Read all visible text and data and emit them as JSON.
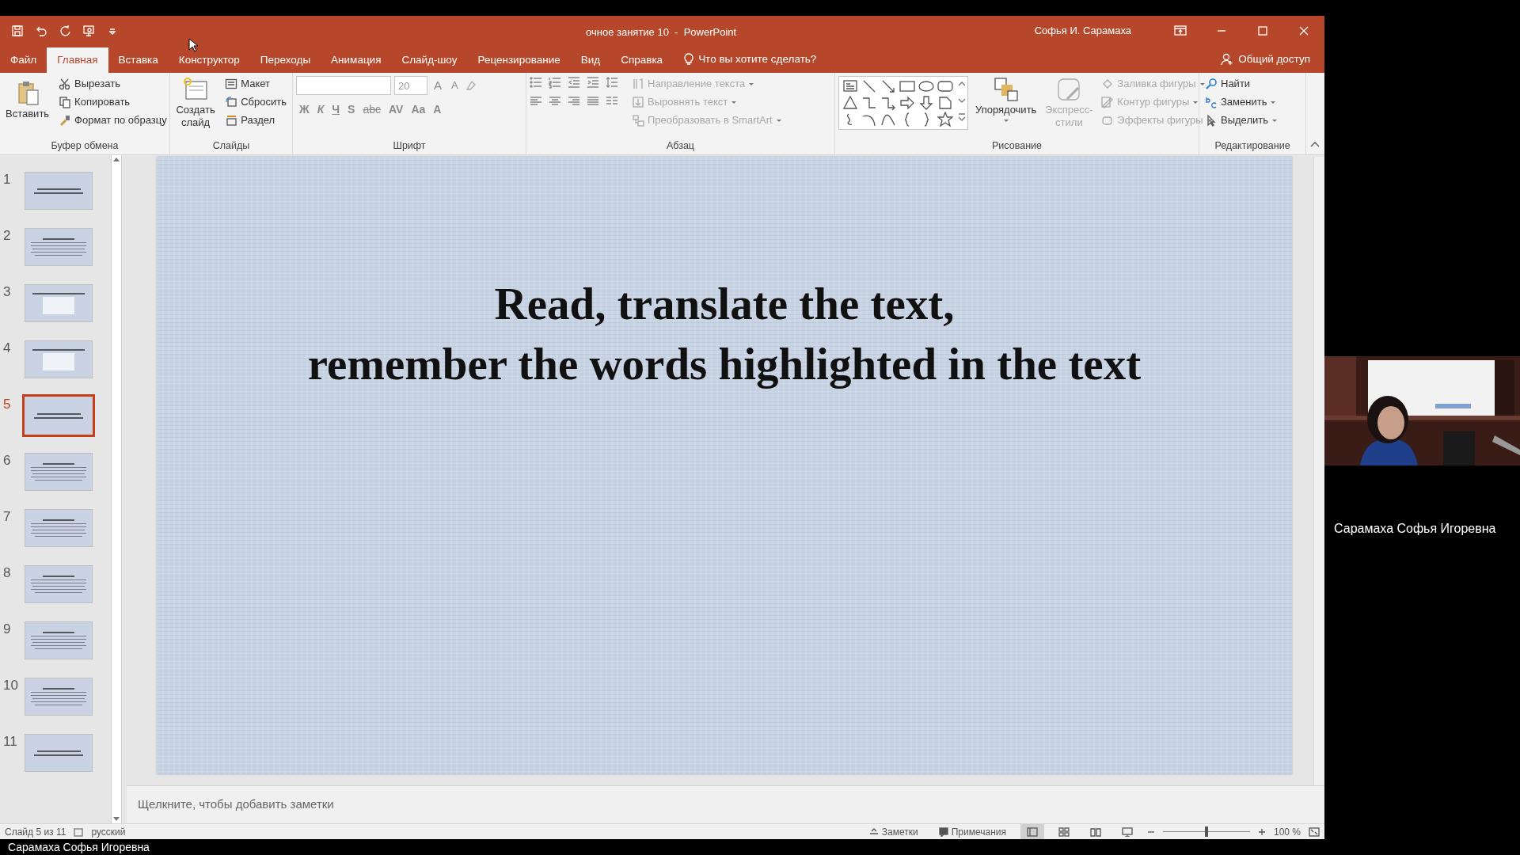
{
  "window": {
    "title": "очное занятие 10  -  PowerPoint",
    "user": "Софья И. Сарамаха"
  },
  "tabs": [
    {
      "label": "Файл",
      "selected": false
    },
    {
      "label": "Главная",
      "selected": true
    },
    {
      "label": "Вставка",
      "selected": false
    },
    {
      "label": "Конструктор",
      "selected": false
    },
    {
      "label": "Переходы",
      "selected": false
    },
    {
      "label": "Анимация",
      "selected": false
    },
    {
      "label": "Слайд-шоу",
      "selected": false
    },
    {
      "label": "Рецензирование",
      "selected": false
    },
    {
      "label": "Вид",
      "selected": false
    },
    {
      "label": "Справка",
      "selected": false
    }
  ],
  "tell_me": "Что вы хотите сделать?",
  "share": "Общий доступ",
  "ribbon": [
    {
      "kind": "clipboard",
      "label": "Буфер обмена",
      "commands": [
        {
          "label": "Вставить",
          "disabled": false
        },
        {
          "label": "Вырезать",
          "disabled": false
        },
        {
          "label": "Копировать",
          "disabled": false
        },
        {
          "label": "Формат по образцу",
          "disabled": false
        }
      ]
    },
    {
      "kind": "slides",
      "label": "Слайды",
      "commands": [
        {
          "label": "Создать слайд",
          "disabled": false
        },
        {
          "label": "Макет",
          "disabled": false
        },
        {
          "label": "Сбросить",
          "disabled": false
        },
        {
          "label": "Раздел",
          "disabled": false
        }
      ]
    },
    {
      "kind": "font",
      "label": "Шрифт",
      "size": "20",
      "size_buttons": [
        "A",
        "A"
      ],
      "buttons": [
        "Ж",
        "К",
        "Ч",
        "S",
        "abc",
        "AV",
        "Aa",
        "A"
      ]
    },
    {
      "kind": "paragraph",
      "label": "Абзац",
      "commands": [
        {
          "label": "Направление текста",
          "disabled": true
        },
        {
          "label": "Выровнять текст",
          "disabled": true
        },
        {
          "label": "Преобразовать в SmartArt",
          "disabled": true
        }
      ]
    },
    {
      "kind": "drawing",
      "label": "Рисование",
      "commands": [
        {
          "label": "Упорядочить",
          "disabled": false
        },
        {
          "label": "Экспресс-стили",
          "disabled": true
        },
        {
          "label": "Заливка фигуры",
          "disabled": true
        },
        {
          "label": "Контур фигуры",
          "disabled": true
        },
        {
          "label": "Эффекты фигуры",
          "disabled": true
        }
      ]
    },
    {
      "kind": "editing",
      "label": "Редактирование",
      "commands": [
        {
          "label": "Найти",
          "disabled": false
        },
        {
          "label": "Заменить",
          "disabled": false
        },
        {
          "label": "Выделить",
          "disabled": false
        }
      ]
    }
  ],
  "thumbnails": [
    {
      "number": "1",
      "kind": "title",
      "selected": false
    },
    {
      "number": "2",
      "kind": "text",
      "selected": false
    },
    {
      "number": "3",
      "kind": "table",
      "selected": false
    },
    {
      "number": "4",
      "kind": "table",
      "selected": false
    },
    {
      "number": "5",
      "kind": "title",
      "selected": true
    },
    {
      "number": "6",
      "kind": "text",
      "selected": false
    },
    {
      "number": "7",
      "kind": "text",
      "selected": false
    },
    {
      "number": "8",
      "kind": "text",
      "selected": false
    },
    {
      "number": "9",
      "kind": "text",
      "selected": false
    },
    {
      "number": "10",
      "kind": "text",
      "selected": false
    },
    {
      "number": "11",
      "kind": "title",
      "selected": false
    }
  ],
  "slide": {
    "title_lines": [
      "Read, translate the text,",
      "remember the words highlighted in the text"
    ]
  },
  "notes": {
    "placeholder": "Щелкните, чтобы добавить заметки"
  },
  "status_bar": {
    "slide_info": "Слайд 5 из 11",
    "language": "русский",
    "notes": "Заметки",
    "comments": "Примечания",
    "views": [
      {
        "selected": true
      },
      {
        "selected": false
      },
      {
        "selected": false
      },
      {
        "selected": false
      }
    ],
    "zoom": {
      "level": 0.5,
      "reading": "100 %"
    }
  },
  "meeting": {
    "participant": {
      "name": "Сарамаха Софья Игоревна",
      "kind": "picture"
    },
    "self_name": "Сарамаха Софья Игоревна"
  }
}
